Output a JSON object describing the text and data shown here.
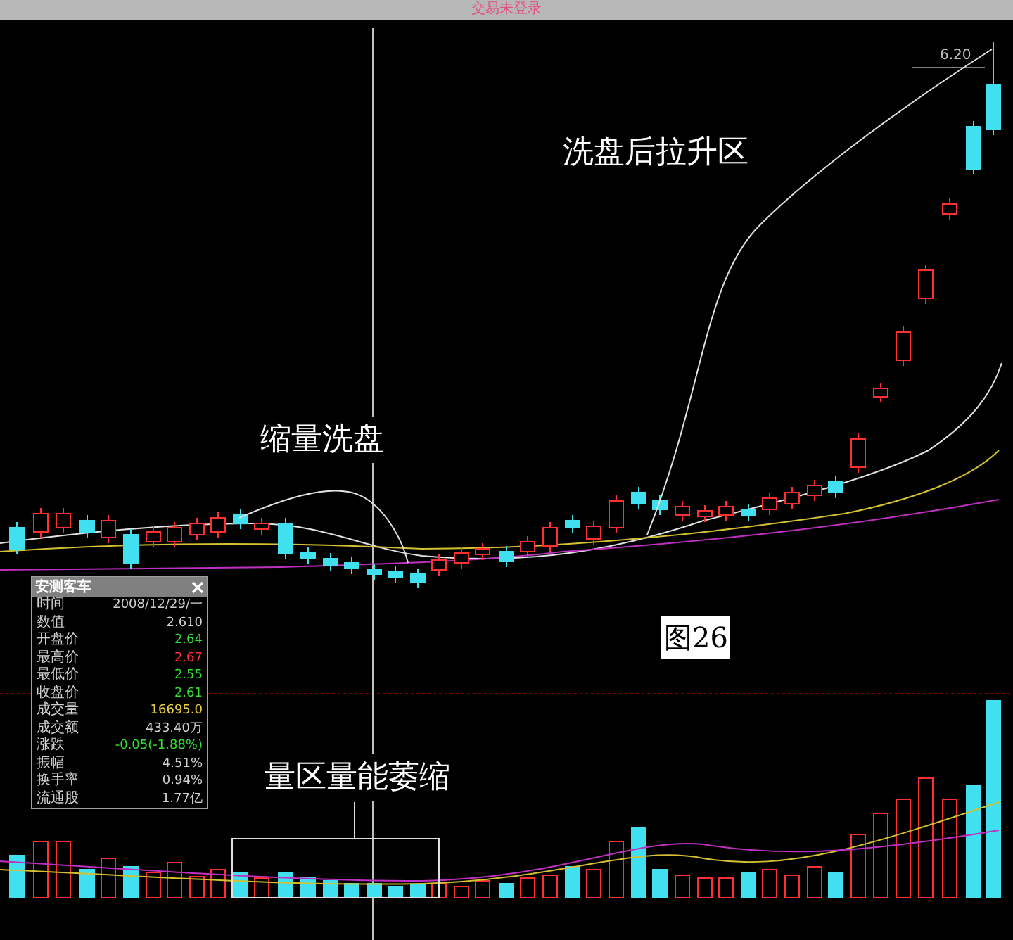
{
  "window": {
    "title": "交易未登录"
  },
  "chart": {
    "price_label": "6.20",
    "figure_label": "图26",
    "annotations": [
      {
        "text": "洗盘后拉升区"
      },
      {
        "text": "缩量洗盘"
      },
      {
        "text": "量区量能萎缩"
      }
    ]
  },
  "info_panel": {
    "title": "安测客车",
    "rows": [
      {
        "label": "时间",
        "value": "2008/12/29/一",
        "color": "#d0d0d0"
      },
      {
        "label": "数值",
        "value": "2.610",
        "color": "#d0d0d0"
      },
      {
        "label": "开盘价",
        "value": "2.64",
        "color": "#33dd33"
      },
      {
        "label": "最高价",
        "value": "2.67",
        "color": "#ff3333"
      },
      {
        "label": "最低价",
        "value": "2.55",
        "color": "#33dd33"
      },
      {
        "label": "收盘价",
        "value": "2.61",
        "color": "#33dd33"
      },
      {
        "label": "成交量",
        "value": "16695.0",
        "color": "#e8d040"
      },
      {
        "label": "成交额",
        "value": "433.40万",
        "color": "#d0d0d0"
      },
      {
        "label": "涨跌",
        "value": "-0.05(-1.88%)",
        "color": "#33dd33"
      },
      {
        "label": "振幅",
        "value": "4.51%",
        "color": "#d0d0d0"
      },
      {
        "label": "换手率",
        "value": "0.94%",
        "color": "#d0d0d0"
      },
      {
        "label": "流通股",
        "value": "1.77亿",
        "color": "#d0d0d0"
      }
    ]
  }
}
